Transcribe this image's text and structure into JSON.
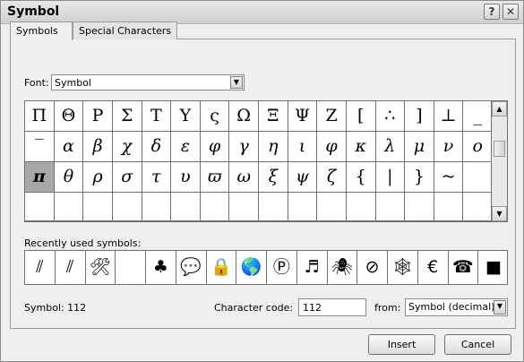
{
  "window": {
    "title": "Symbol",
    "help_glyph": "?",
    "close_glyph": "✕"
  },
  "tabs": [
    {
      "label": "Symbols"
    },
    {
      "label": "Special Characters"
    }
  ],
  "font": {
    "label": "Font:",
    "value": "Symbol"
  },
  "symbols": {
    "rows": [
      [
        "Π",
        "Θ",
        "Ρ",
        "Σ",
        "Τ",
        "Υ",
        "ς",
        "Ω",
        "Ξ",
        "Ψ",
        "Ζ",
        "[",
        "∴",
        "]",
        "⊥",
        "_"
      ],
      [
        "‾",
        "α",
        "β",
        "χ",
        "δ",
        "ε",
        "φ",
        "γ",
        "η",
        "ι",
        "φ",
        "κ",
        "λ",
        "μ",
        "ν",
        "ο"
      ],
      [
        "π",
        "θ",
        "ρ",
        "σ",
        "τ",
        "υ",
        "ϖ",
        "ω",
        "ξ",
        "ψ",
        "ζ",
        "{",
        "|",
        "}",
        "~",
        ""
      ],
      [
        "",
        "",
        "",
        "",
        "",
        "",
        "",
        "",
        "",
        "",
        "",
        "",
        "",
        "",
        "",
        ""
      ]
    ],
    "selected": "π"
  },
  "recent": {
    "label": "Recently used symbols:",
    "items": [
      "⫽",
      "⫽",
      "🛠",
      "",
      "♣",
      "💬",
      "🔒",
      "🌎",
      "Ⓟ",
      "♬",
      "🕷",
      "⊘",
      "🕸",
      "€",
      "☎",
      "■"
    ]
  },
  "status": {
    "symbol_label": "Symbol: 112",
    "char_code_label": "Character code:",
    "char_code_value": "112",
    "from_label": "from:",
    "from_value": "Symbol (decimal)"
  },
  "buttons": {
    "insert": "Insert",
    "cancel": "Cancel"
  }
}
